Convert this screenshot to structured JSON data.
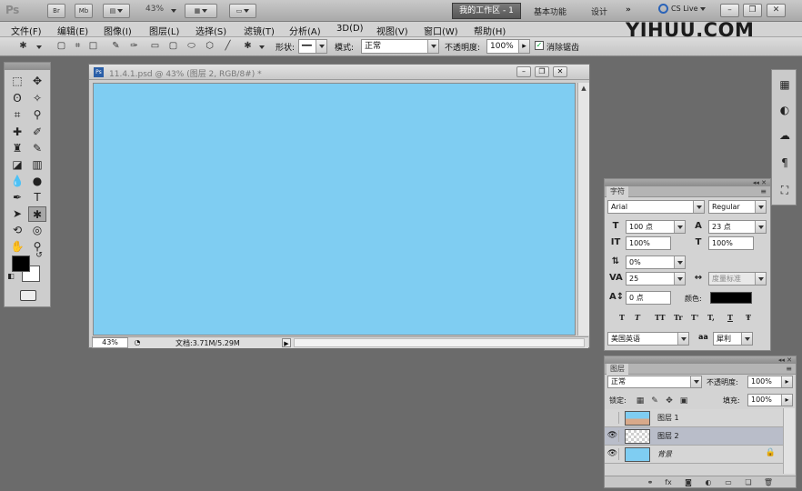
{
  "appbar": {
    "logo": "Ps",
    "br_label": "Br",
    "mb_label": "Mb",
    "zoom_value": "43%",
    "active_workspace": "我的工作区 - 1",
    "workspaces": [
      "基本功能",
      "设计"
    ],
    "more_label": "»",
    "cs_live": "CS Live"
  },
  "menubar": {
    "items": [
      "文件(F)",
      "编辑(E)",
      "图像(I)",
      "图层(L)",
      "选择(S)",
      "滤镜(T)",
      "分析(A)",
      "3D(D)",
      "视图(V)",
      "窗口(W)",
      "帮助(H)"
    ]
  },
  "watermark": "YIHUU.COM",
  "optionsbar": {
    "shape_label": "形状:",
    "mode_label": "模式:",
    "mode_value": "正常",
    "opacity_label": "不透明度:",
    "opacity_value": "100%",
    "antialias_label": "消除锯齿"
  },
  "document": {
    "title": "11.4.1.psd @ 43% (图层 2, RGB/8#) *",
    "canvas_color": "#7fcdf2",
    "zoom": "43%",
    "doc_info": "文档:3.71M/5.29M"
  },
  "character": {
    "tab": "字符",
    "font_family": "Arial",
    "font_style": "Regular",
    "size": "100 点",
    "leading": "23 点",
    "v_scale": "100%",
    "h_scale": "100%",
    "baseline": "0%",
    "tracking": "25",
    "kerning": "度量标准",
    "shift": "0 点",
    "color_label": "颜色:",
    "color_value": "#000000",
    "style_buttons": [
      "T",
      "T",
      "TT",
      "Tr",
      "T'",
      "T,",
      "T",
      "Ŧ"
    ],
    "language": "美国英语",
    "aa_symbol": "aa",
    "aa_value": "犀利"
  },
  "layers": {
    "tab": "图层",
    "blend_mode": "正常",
    "opacity_label": "不透明度:",
    "opacity_value": "100%",
    "lock_label": "锁定:",
    "fill_label": "填充:",
    "fill_value": "100%",
    "rows": [
      {
        "name": "图层 1",
        "visible": false,
        "selected": false
      },
      {
        "name": "图层 2",
        "visible": true,
        "selected": true
      },
      {
        "name": "背景",
        "visible": true,
        "selected": false
      }
    ]
  }
}
